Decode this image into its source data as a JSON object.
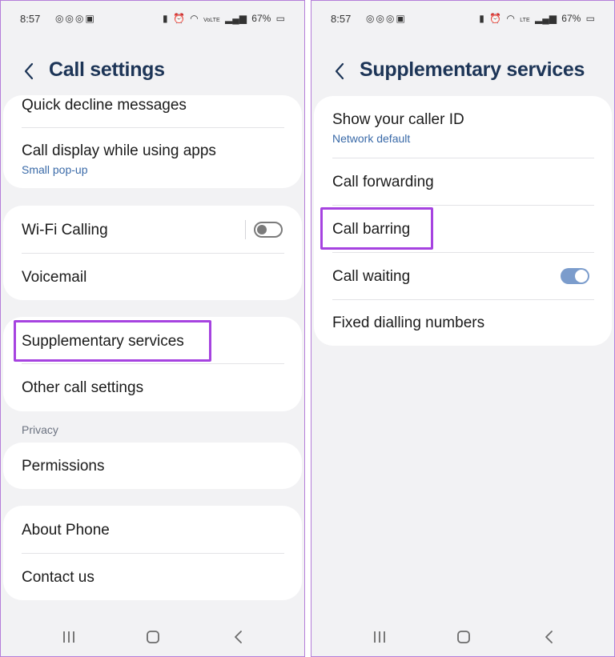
{
  "status": {
    "time": "8:57",
    "app_icons": [
      "instagram-icon",
      "instagram-icon",
      "instagram-icon",
      "gallery-icon"
    ],
    "battery": "67%",
    "network": "VoLTE",
    "cellular": "LTE"
  },
  "left": {
    "title": "Call settings",
    "card1": {
      "items": [
        {
          "title": "Quick decline messages"
        },
        {
          "title": "Call display while using apps",
          "subtitle": "Small pop-up"
        }
      ]
    },
    "card2": {
      "items": [
        {
          "title": "Wi-Fi Calling",
          "toggle": "off"
        },
        {
          "title": "Voicemail"
        }
      ]
    },
    "card3": {
      "items": [
        {
          "title": "Supplementary services"
        },
        {
          "title": "Other call settings"
        }
      ]
    },
    "privacy_label": "Privacy",
    "card4": {
      "items": [
        {
          "title": "Permissions"
        }
      ]
    },
    "card5": {
      "items": [
        {
          "title": "About Phone"
        },
        {
          "title": "Contact us"
        }
      ]
    }
  },
  "right": {
    "title": "Supplementary services",
    "items": [
      {
        "title": "Show your caller ID",
        "subtitle": "Network default"
      },
      {
        "title": "Call forwarding"
      },
      {
        "title": "Call barring"
      },
      {
        "title": "Call waiting",
        "toggle": "on"
      },
      {
        "title": "Fixed dialling numbers"
      }
    ]
  },
  "colors": {
    "highlight": "#a643e0",
    "accent": "#3a6aa8",
    "title": "#1d3557",
    "toggle_on": "#7b9ccc"
  }
}
